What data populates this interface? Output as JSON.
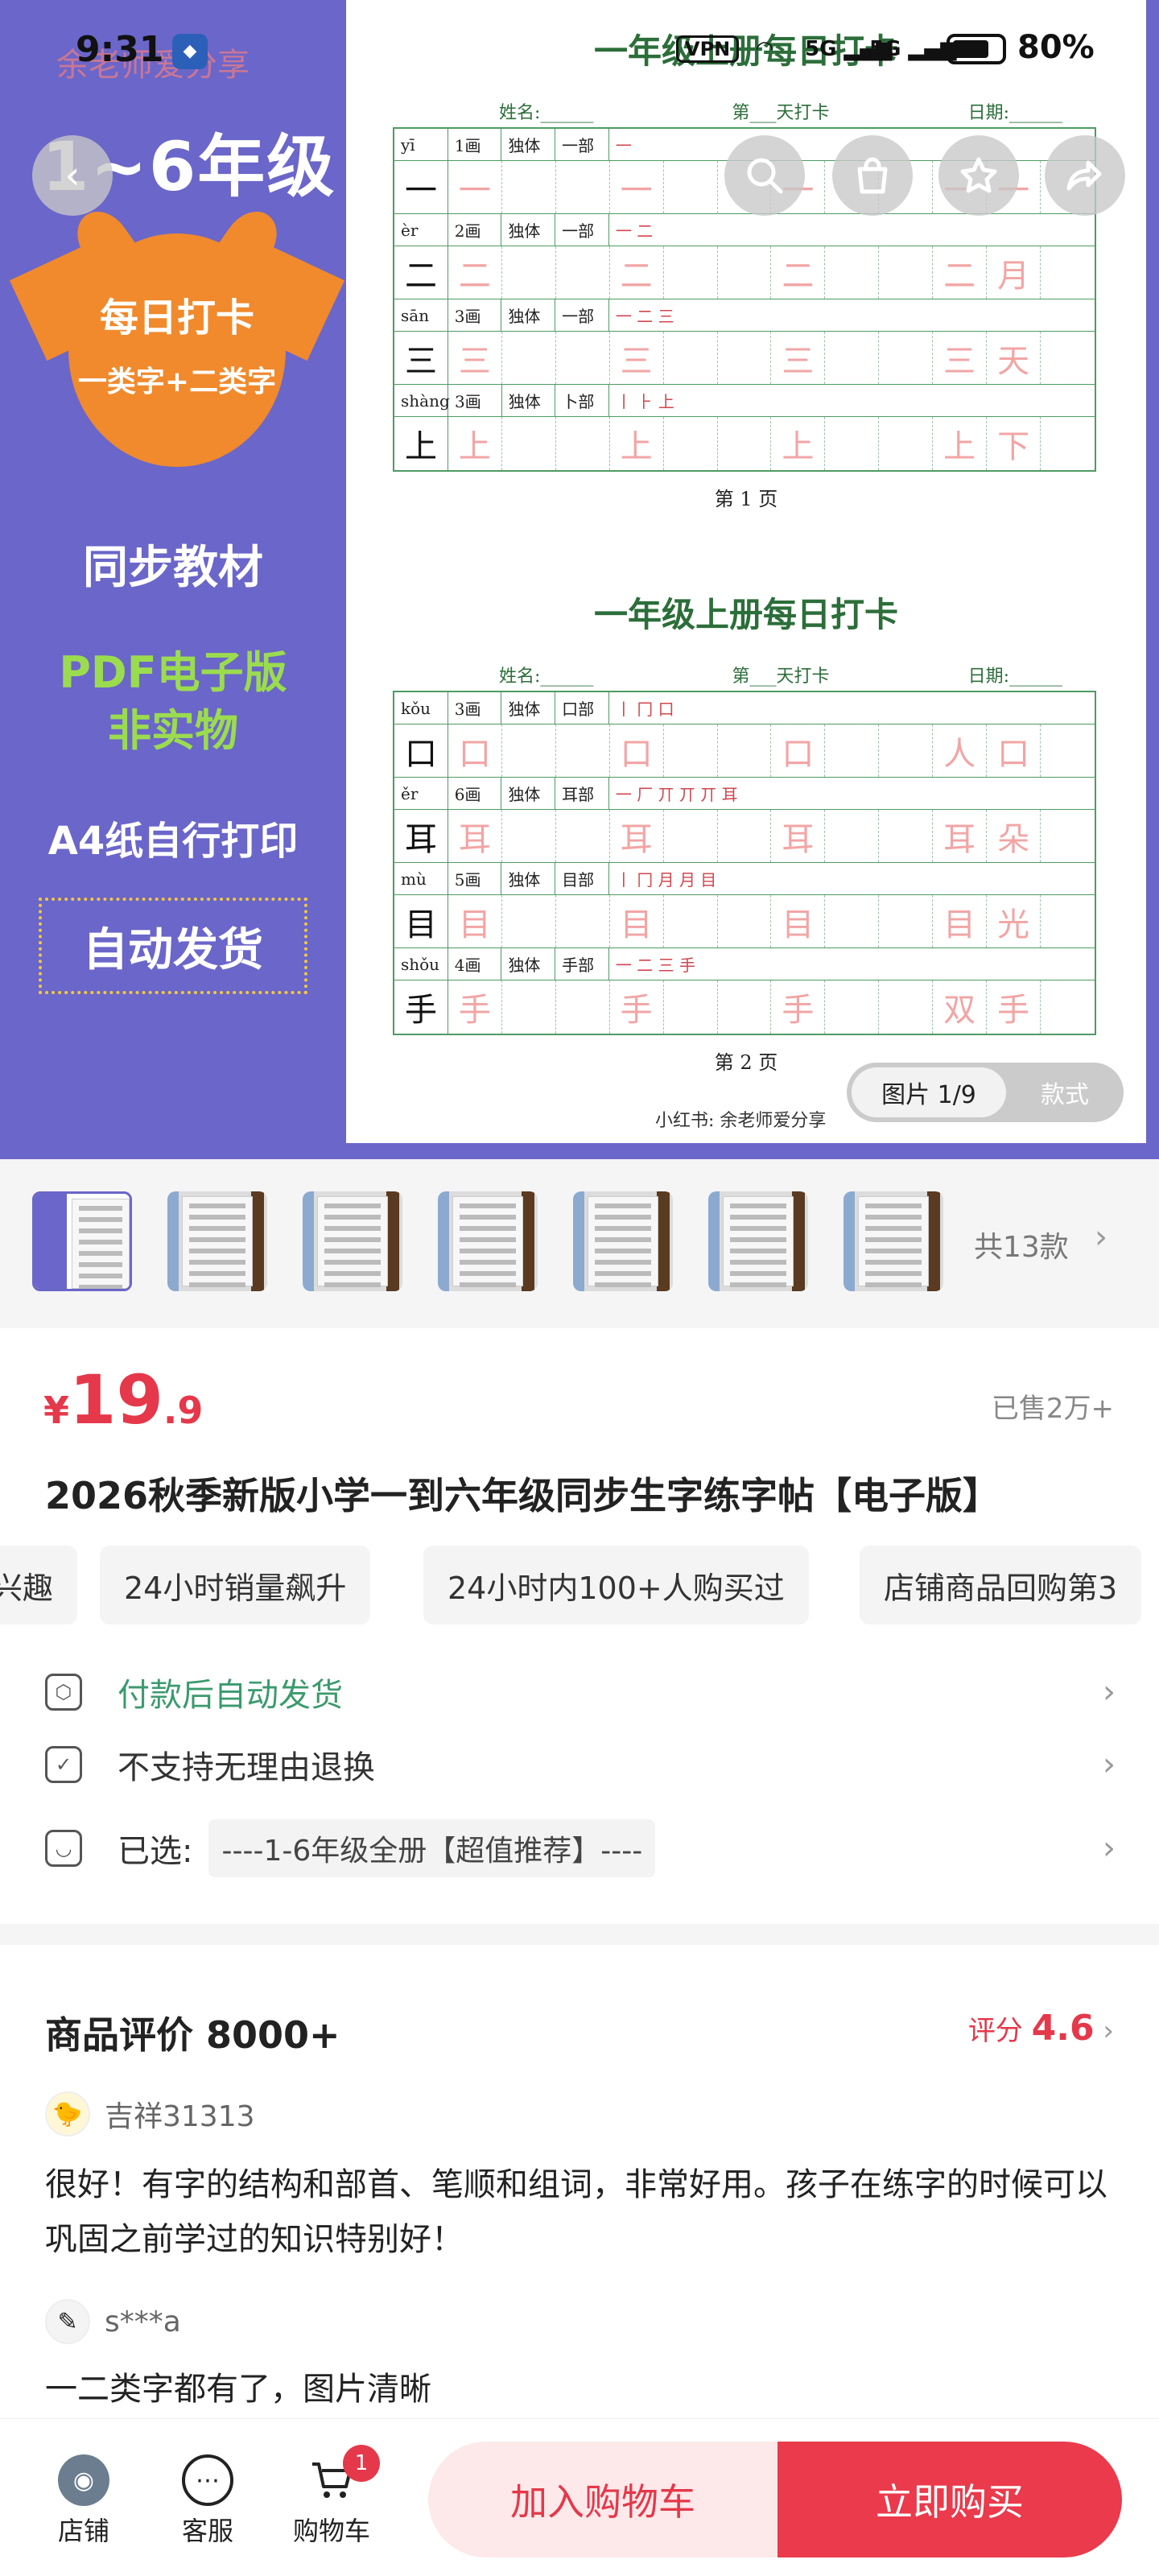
{
  "status_bar": {
    "time": "9:31",
    "vpn": "VPN",
    "signal_text": "5G",
    "battery": "80%"
  },
  "hero": {
    "watermark": "余老师爱分享",
    "grade": "1~6年级",
    "badge_line1": "每日打卡",
    "badge_line2": "一类字+二类字",
    "line1": "同步教材",
    "line2a": "PDF电子版",
    "line2b": "非实物",
    "line3": "A4纸自行打印",
    "ship": "自动发货",
    "sheet": {
      "title": "一年级上册每日打卡",
      "meta_name": "姓名:______",
      "meta_day": "第___天打卡",
      "meta_date": "日期:______",
      "footer": "小红书: 余老师爱分享",
      "pages": [
        {
          "page_label": "第 1 页",
          "rows": [
            {
              "pinyin": "yī",
              "strokes": "1画",
              "struct": "独体",
              "radical": "一部",
              "order": "一",
              "char": "一",
              "words": [
                "一",
                "一"
              ]
            },
            {
              "pinyin": "èr",
              "strokes": "2画",
              "struct": "独体",
              "radical": "一部",
              "order": "一 二",
              "char": "二",
              "words": [
                "二",
                "月"
              ]
            },
            {
              "pinyin": "sān",
              "strokes": "3画",
              "struct": "独体",
              "radical": "一部",
              "order": "一 二 三",
              "char": "三",
              "words": [
                "三",
                "天"
              ]
            },
            {
              "pinyin": "shàng",
              "strokes": "3画",
              "struct": "独体",
              "radical": "卜部",
              "order": "丨 ⺊ 上",
              "char": "上",
              "words": [
                "上",
                "下"
              ]
            }
          ]
        },
        {
          "page_label": "第 2 页",
          "rows": [
            {
              "pinyin": "kǒu",
              "strokes": "3画",
              "struct": "独体",
              "radical": "口部",
              "order": "丨 冂 口",
              "char": "口",
              "words": [
                "人",
                "口"
              ]
            },
            {
              "pinyin": "ěr",
              "strokes": "6画",
              "struct": "独体",
              "radical": "耳部",
              "order": "一 厂 丌 丌 丌 耳",
              "char": "耳",
              "words": [
                "耳",
                "朵"
              ]
            },
            {
              "pinyin": "mù",
              "strokes": "5画",
              "struct": "独体",
              "radical": "目部",
              "order": "丨 冂 月 月 目",
              "char": "目",
              "words": [
                "目",
                "光"
              ]
            },
            {
              "pinyin": "shǒu",
              "strokes": "4画",
              "struct": "独体",
              "radical": "手部",
              "order": "一 二 三 手",
              "char": "手",
              "words": [
                "双",
                "手"
              ]
            }
          ]
        }
      ]
    },
    "pager": {
      "active": "图片 1/9",
      "other": "款式"
    }
  },
  "thumbs": {
    "count_label": "共13款"
  },
  "product": {
    "currency": "¥",
    "price_int": "19",
    "price_dec": ".9",
    "sold": "已售2万+",
    "title": "2026秋季新版小学一到六年级同步生字练字帖【电子版】",
    "tags": [
      "兴趣",
      "24小时销量飙升",
      "24小时内100+人购买过",
      "店铺商品回购第3"
    ],
    "service1": "付款后自动发货",
    "service2": "不支持无理由退换",
    "selected_label": "已选:",
    "selected_value": "----1-6年级全册【超值推荐】----"
  },
  "reviews": {
    "title": "商品评价 8000+",
    "score_label": "评分",
    "score": "4.6",
    "items": [
      {
        "user": "吉祥31313",
        "text": "很好！有字的结构和部首、笔顺和组词，非常好用。孩子在练字的时候可以巩固之前学过的知识特别好！"
      },
      {
        "user": "s***a",
        "text": "一二类字都有了，图片清晰"
      }
    ]
  },
  "bottom_bar": {
    "store": "店铺",
    "service": "客服",
    "cart": "购物车",
    "cart_badge": "1",
    "add_cart": "加入购物车",
    "buy_now": "立即购买"
  }
}
